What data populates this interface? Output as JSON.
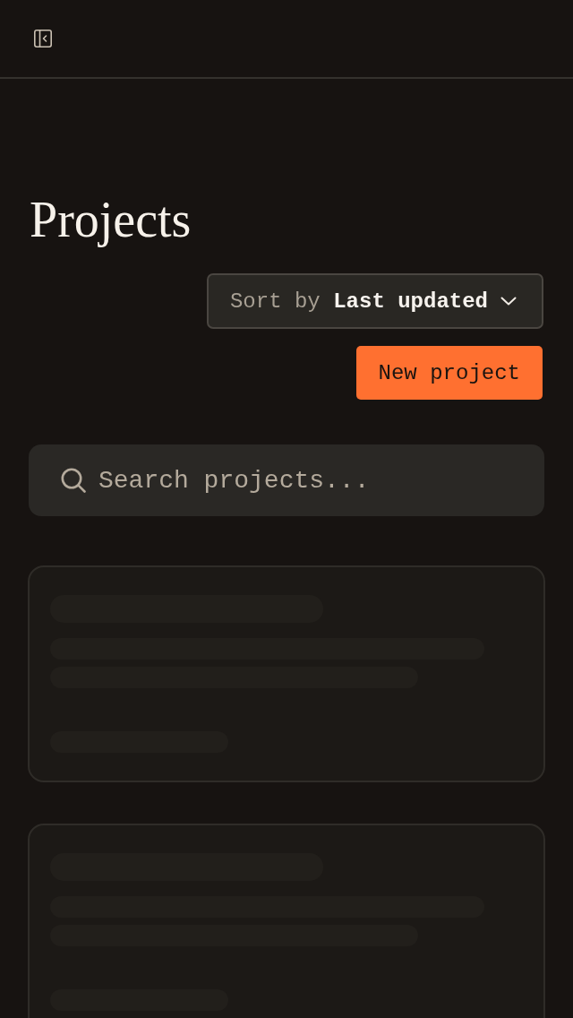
{
  "page": {
    "title": "Projects"
  },
  "sort": {
    "prefix": "Sort by",
    "value": "Last updated"
  },
  "new_project_button": {
    "label": "New project"
  },
  "search": {
    "placeholder": "Search projects..."
  },
  "project_cards": [
    {
      "kind": "skeleton"
    },
    {
      "kind": "skeleton"
    }
  ]
}
